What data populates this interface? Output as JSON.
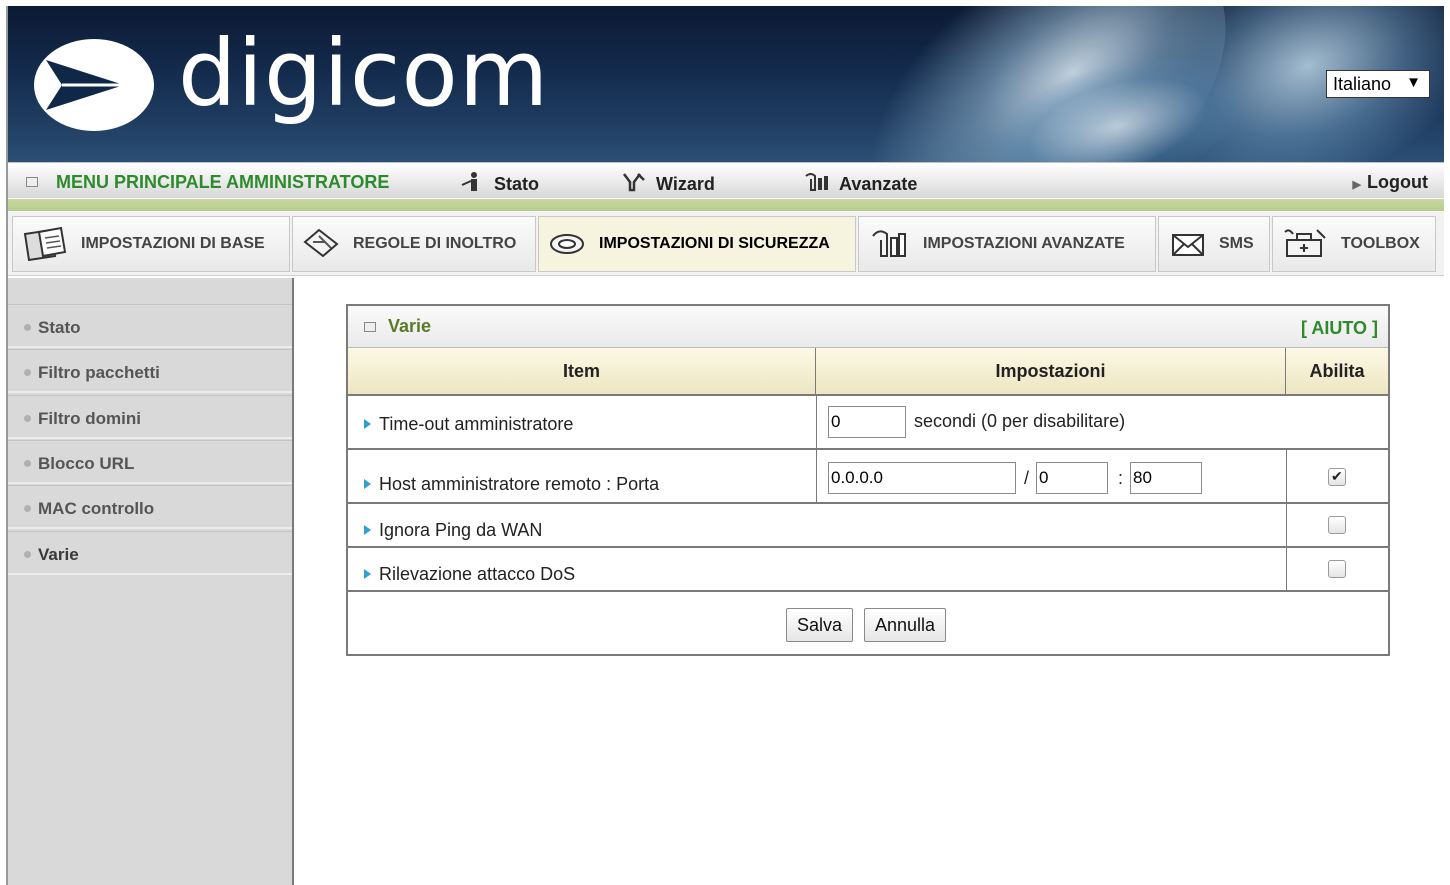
{
  "header": {
    "brand": "digicom",
    "language": "Italiano"
  },
  "topbar": {
    "admin_menu": "MENU PRINCIPALE AMMINISTRATORE",
    "stato": "Stato",
    "wizard": "Wizard",
    "avanzate": "Avanzate",
    "logout": "Logout"
  },
  "tabs": [
    {
      "label": "IMPOSTAZIONI DI BASE",
      "icon": "folder-icon"
    },
    {
      "label": "REGOLE DI INOLTRO",
      "icon": "arrows-icon"
    },
    {
      "label": "IMPOSTAZIONI DI SICUREZZA",
      "icon": "shield-icon",
      "active": true
    },
    {
      "label": "IMPOSTAZIONI AVANZATE",
      "icon": "tools-icon"
    },
    {
      "label": "SMS",
      "icon": "envelope-icon"
    },
    {
      "label": "TOOLBOX",
      "icon": "toolbox-icon"
    }
  ],
  "sidebar": {
    "items": [
      {
        "label": "Stato"
      },
      {
        "label": "Filtro pacchetti"
      },
      {
        "label": "Filtro domini"
      },
      {
        "label": "Blocco URL"
      },
      {
        "label": "MAC controllo"
      },
      {
        "label": "Varie"
      }
    ]
  },
  "panel": {
    "title": "Varie",
    "help": "[ AIUTO ]",
    "columns": {
      "item": "Item",
      "settings": "Impostazioni",
      "enable": "Abilita"
    },
    "rows": [
      {
        "label": "Time-out amministratore",
        "value": "0",
        "suffix": "secondi (0 per disabilitare)"
      },
      {
        "label": "Host amministratore remoto : Porta",
        "host": "0.0.0.0",
        "sep1": "/",
        "mask": "0",
        "sep2": ":",
        "port": "80",
        "enabled": true
      },
      {
        "label": "Ignora Ping da WAN",
        "enabled": false
      },
      {
        "label": "Rilevazione attacco DoS",
        "enabled": false
      }
    ],
    "buttons": {
      "save": "Salva",
      "cancel": "Annulla"
    }
  },
  "colors": {
    "accent_green": "#2d8a2d",
    "title_olive": "#5a7a2a",
    "header_bg": "#ede6c2",
    "bullet_blue": "#2f9fd0"
  }
}
